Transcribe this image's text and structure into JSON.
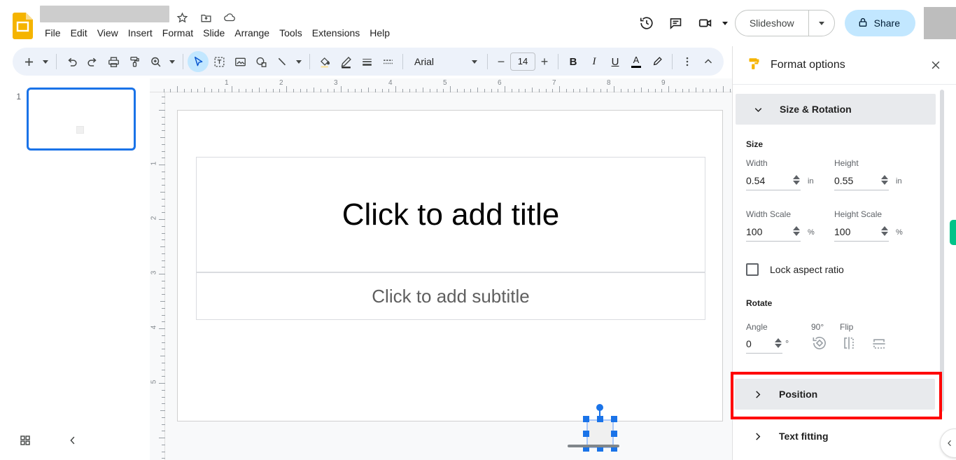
{
  "app": {
    "name": "Google Slides",
    "doc_title": "",
    "title_icons": [
      "star-icon",
      "move-to-folder-icon",
      "cloud-saved-icon"
    ]
  },
  "menubar": {
    "items": [
      "File",
      "Edit",
      "View",
      "Insert",
      "Format",
      "Slide",
      "Arrange",
      "Tools",
      "Extensions",
      "Help"
    ]
  },
  "topright": {
    "history_icon": "version-history-icon",
    "comment_icon": "comment-icon",
    "meet_icon": "meet-camera-icon",
    "slideshow_label": "Slideshow",
    "share_label": "Share",
    "lock_icon": "lock-icon"
  },
  "toolbar": {
    "new_slide": "add-slide-icon",
    "undo": "undo-icon",
    "redo": "redo-icon",
    "print": "print-icon",
    "paint_format": "paint-format-icon",
    "zoom": "zoom-icon",
    "select": "select-cursor-icon",
    "textbox": "text-box-icon",
    "image": "insert-image-icon",
    "shape": "shape-icon",
    "line": "line-icon",
    "fill_color": "fill-color-icon",
    "border_color": "border-color-icon",
    "border_weight": "border-weight-icon",
    "border_dash": "border-dash-icon",
    "font_family": "Arial",
    "font_size": "14",
    "decrease_font": "−",
    "increase_font": "+",
    "bold": "B",
    "italic": "I",
    "underline": "U",
    "text_color": "A",
    "highlight": "highlight-pen-icon",
    "more": "more-options-icon",
    "collapse": "collapse-toolbar-icon"
  },
  "filmstrip": {
    "slides": [
      {
        "number": "1"
      }
    ],
    "grid_view_icon": "grid-view-icon",
    "collapse_icon": "collapse-filmstrip-icon"
  },
  "canvas": {
    "ruler_h_labels": [
      "1",
      "2",
      "3",
      "4",
      "5",
      "6",
      "7",
      "8",
      "9"
    ],
    "ruler_v_labels": [
      "1",
      "2",
      "3",
      "4",
      "5"
    ],
    "title_placeholder": "Click to add title",
    "subtitle_placeholder": "Click to add subtitle",
    "selected_object": "shape"
  },
  "format_panel": {
    "header_title": "Format options",
    "header_icon": "format-paint-roller-icon",
    "close_icon": "close-icon",
    "sections": {
      "size_rotation": {
        "label": "Size & Rotation",
        "expanded": true,
        "size_label": "Size",
        "width_label": "Width",
        "width_value": "0.54",
        "width_unit": "in",
        "height_label": "Height",
        "height_value": "0.55",
        "height_unit": "in",
        "width_scale_label": "Width Scale",
        "width_scale_value": "100",
        "width_scale_unit": "%",
        "height_scale_label": "Height Scale",
        "height_scale_value": "100",
        "height_scale_unit": "%",
        "lock_aspect_label": "Lock aspect ratio",
        "lock_aspect_checked": false,
        "rotate_label": "Rotate",
        "angle_label": "Angle",
        "angle_value": "0",
        "angle_unit": "°",
        "rotate90_label": "90°",
        "rotate90_icon": "rotate-90-icon",
        "flip_label": "Flip",
        "flip_horizontal_icon": "flip-horizontal-icon",
        "flip_vertical_icon": "flip-vertical-icon"
      },
      "position": {
        "label": "Position",
        "expanded": false,
        "highlighted": true
      },
      "text_fitting": {
        "label": "Text fitting",
        "expanded": false
      }
    }
  },
  "edge": {
    "collapse_icon": "collapse-panel-icon",
    "green_indicator": "#00c389"
  },
  "colors": {
    "accent_blue": "#1a73e8",
    "toolbar_bg": "#edf2fa",
    "share_bg": "#c2e7ff",
    "section_bg": "#e8eaed",
    "highlight_red": "#ff0000",
    "logo_yellow": "#f5b400"
  }
}
